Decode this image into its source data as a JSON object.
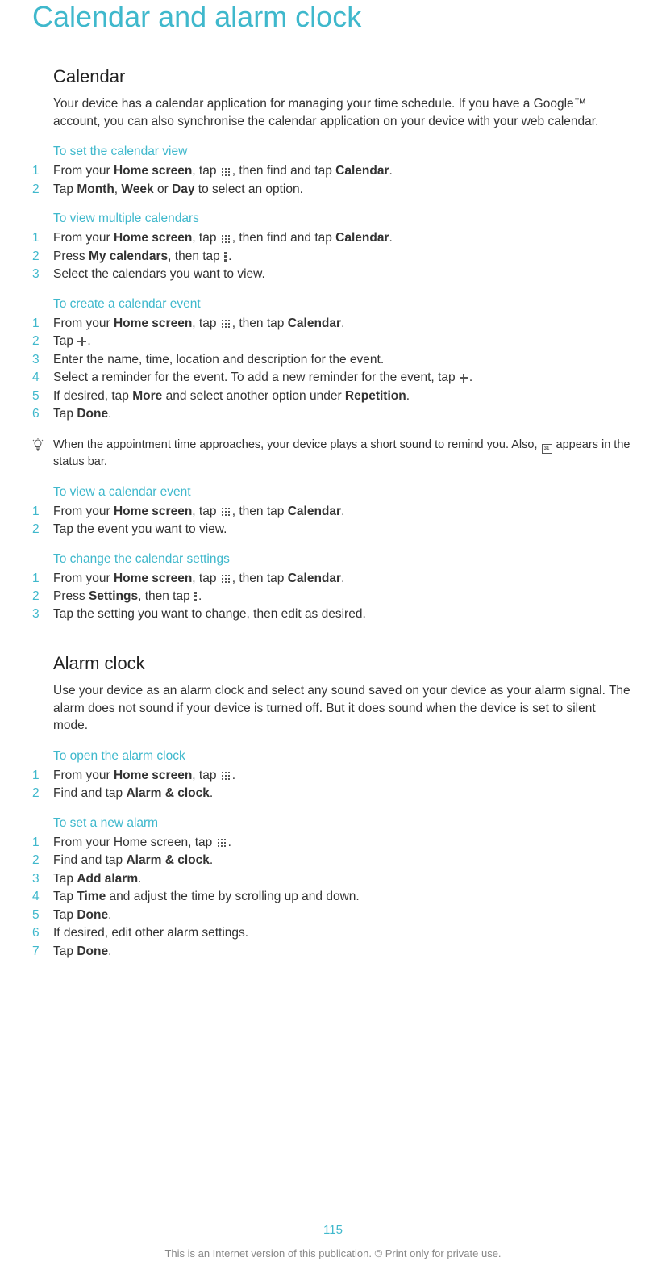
{
  "pageTitle": "Calendar and alarm clock",
  "pageNumber": "115",
  "footerNote": "This is an Internet version of this publication. © Print only for private use.",
  "calendar": {
    "title": "Calendar",
    "intro": "Your device has a calendar application for managing your time schedule. If you have a Google™ account, you can also synchronise the calendar application on your device with your web calendar.",
    "setView": {
      "header": "To set the calendar view",
      "steps": [
        {
          "n": "1",
          "pre": "From your ",
          "b1": "Home screen",
          "mid": ", tap ",
          "icon": "grid",
          "post": ", then find and tap ",
          "b2": "Calendar",
          "tail": "."
        },
        {
          "n": "2",
          "pre": "Tap ",
          "b1": "Month",
          "mid": ", ",
          "b2": "Week",
          "mid2": " or ",
          "b3": "Day",
          "tail": " to select an option."
        }
      ]
    },
    "viewMultiple": {
      "header": "To view multiple calendars",
      "steps": [
        {
          "n": "1",
          "pre": "From your ",
          "b1": "Home screen",
          "mid": ", tap ",
          "icon": "grid",
          "post": ", then find and tap ",
          "b2": "Calendar",
          "tail": "."
        },
        {
          "n": "2",
          "pre": "Press ",
          "icon": "options",
          "mid": ", then tap ",
          "b1": "My calendars",
          "tail": "."
        },
        {
          "n": "3",
          "pre": "Select the calendars you want to view."
        }
      ]
    },
    "createEvent": {
      "header": "To create a calendar event",
      "steps": [
        {
          "n": "1",
          "pre": "From your ",
          "b1": "Home screen",
          "mid": ", tap ",
          "icon": "grid",
          "post": ", then tap ",
          "b2": "Calendar",
          "tail": "."
        },
        {
          "n": "2",
          "pre": "Tap ",
          "icon": "plus",
          "tail": "."
        },
        {
          "n": "3",
          "pre": "Enter the name, time, location and description for the event."
        },
        {
          "n": "4",
          "pre": "Select a reminder for the event. To add a new reminder for the event, tap ",
          "icon": "plus",
          "tail": "."
        },
        {
          "n": "5",
          "pre": "If desired, tap ",
          "b1": "More",
          "mid": " and select another option under ",
          "b2": "Repetition",
          "tail": "."
        },
        {
          "n": "6",
          "pre": "Tap ",
          "b1": "Done",
          "tail": "."
        }
      ],
      "tip": {
        "pre": "When the appointment time approaches, your device plays a short sound to remind you. Also, ",
        "icon": "cal",
        "calText": "31",
        "post": " appears in the status bar."
      }
    },
    "viewEvent": {
      "header": "To view a calendar event",
      "steps": [
        {
          "n": "1",
          "pre": "From your ",
          "b1": "Home screen",
          "mid": ", tap ",
          "icon": "grid",
          "post": ", then tap ",
          "b2": "Calendar",
          "tail": "."
        },
        {
          "n": "2",
          "pre": "Tap the event you want to view."
        }
      ]
    },
    "changeSettings": {
      "header": "To change the calendar settings",
      "steps": [
        {
          "n": "1",
          "pre": "From your ",
          "b1": "Home screen",
          "mid": ", tap ",
          "icon": "grid",
          "post": ", then tap ",
          "b2": "Calendar",
          "tail": "."
        },
        {
          "n": "2",
          "pre": "Press ",
          "icon": "options",
          "mid": ", then tap ",
          "b1": "Settings",
          "tail": "."
        },
        {
          "n": "3",
          "pre": "Tap the setting you want to change, then edit as desired."
        }
      ]
    }
  },
  "alarm": {
    "title": "Alarm clock",
    "intro": "Use your device as an alarm clock and select any sound saved on your device as your alarm signal. The alarm does not sound if your device is turned off. But it does sound when the device is set to silent mode.",
    "open": {
      "header": "To open the alarm clock",
      "steps": [
        {
          "n": "1",
          "pre": "From your ",
          "b1": "Home screen",
          "mid": ", tap ",
          "icon": "grid",
          "tail": "."
        },
        {
          "n": "2",
          "pre": "Find and tap ",
          "b1": "Alarm & clock",
          "tail": "."
        }
      ]
    },
    "setNew": {
      "header": "To set a new alarm",
      "steps": [
        {
          "n": "1",
          "pre": "From your Home screen, tap ",
          "icon": "grid",
          "tail": "."
        },
        {
          "n": "2",
          "pre": "Find and tap ",
          "b1": "Alarm & clock",
          "tail": "."
        },
        {
          "n": "3",
          "pre": "Tap ",
          "b1": "Add alarm",
          "tail": "."
        },
        {
          "n": "4",
          "pre": "Tap ",
          "b1": "Time",
          "mid": " and adjust the time by scrolling up and down."
        },
        {
          "n": "5",
          "pre": "Tap ",
          "b1": "Done",
          "tail": "."
        },
        {
          "n": "6",
          "pre": "If desired, edit other alarm settings."
        },
        {
          "n": "7",
          "pre": "Tap ",
          "b1": "Done",
          "tail": "."
        }
      ]
    }
  }
}
